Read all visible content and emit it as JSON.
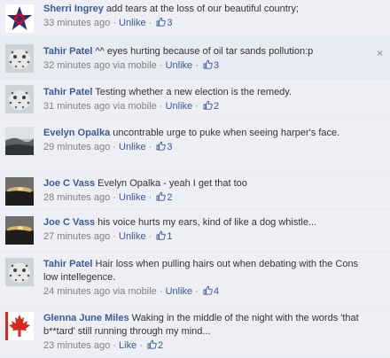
{
  "comments": [
    {
      "name": "Sherri Ingrey",
      "text": "add tears at the loss of our beautiful country;",
      "time": "33 minutes ago",
      "via": "",
      "action": "Unlike",
      "likes": "3",
      "avatar": "star-logo"
    },
    {
      "name": "Tahir Patel",
      "text": "^^ eyes hurting because of oil tar sands pollution:p",
      "time": "32 minutes ago",
      "via": "via mobile",
      "action": "Unlike",
      "likes": "3",
      "avatar": "snow-leopard",
      "close": "×"
    },
    {
      "name": "Tahir Patel",
      "text": "Testing whether a new election is the remedy.",
      "time": "31 minutes ago",
      "via": "via mobile",
      "action": "Unlike",
      "likes": "2",
      "avatar": "snow-leopard"
    },
    {
      "name": "Evelyn Opalka",
      "text": "uncontrable urge to puke when seeing harper's face.",
      "time": "29 minutes ago",
      "via": "",
      "action": "Unlike",
      "likes": "3",
      "avatar": "landscape"
    },
    {
      "name": "Joe C Vass",
      "text": "Evelyn Opalka - yeah I get that too",
      "time": "28 minutes ago",
      "via": "",
      "action": "Unlike",
      "likes": "2",
      "avatar": "sunset"
    },
    {
      "name": "Joe C Vass",
      "text": "his voice hurts my ears, kind of like a dog whistle...",
      "time": "27 minutes ago",
      "via": "",
      "action": "Unlike",
      "likes": "1",
      "avatar": "sunset"
    },
    {
      "name": "Tahir Patel",
      "text": "Hair loss when pulling hairs out when debating with the Cons low intellegence.",
      "time": "24 minutes ago",
      "via": "via mobile",
      "action": "Unlike",
      "likes": "4",
      "avatar": "snow-leopard"
    },
    {
      "name": "Glenna June Miles",
      "text": "Waking in the middle of the night with the words 'that b**tard' still running through my mind...",
      "time": "23 minutes ago",
      "via": "",
      "action": "Like",
      "likes": "2",
      "avatar": "maple-leaf"
    }
  ],
  "separator": "·",
  "colors": {
    "background": "#edeff4",
    "name": "#3b5998",
    "meta": "#808080"
  }
}
